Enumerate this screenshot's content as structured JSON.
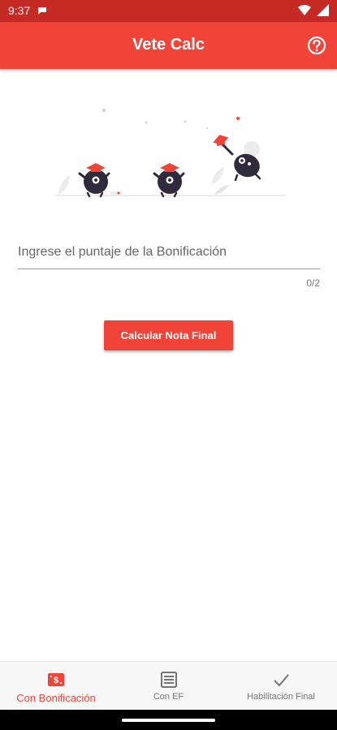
{
  "status_bar": {
    "time": "9:37",
    "icons": [
      "message-icon",
      "wifi-icon",
      "signal-icon"
    ]
  },
  "app_bar": {
    "title": "Vete Calc",
    "help_icon": "help-circle-icon"
  },
  "form": {
    "input_value": "",
    "input_placeholder": "Ingrese el puntaje de la Bonificación",
    "counter": "0/2",
    "calc_button_label": "Calcular Nota Final"
  },
  "bottom_nav": {
    "items": [
      {
        "label": "Con Bonificación",
        "icon": "bonus-icon",
        "active": true
      },
      {
        "label": "Con EF",
        "icon": "list-icon",
        "active": false
      },
      {
        "label": "Habilitación Final",
        "icon": "check-icon",
        "active": false
      }
    ]
  },
  "colors": {
    "primary": "#f04438",
    "status_bar": "#c62a24",
    "nav_background": "#f7f7f7",
    "inactive": "#757575",
    "illustration_dark": "#2f2b3d"
  }
}
